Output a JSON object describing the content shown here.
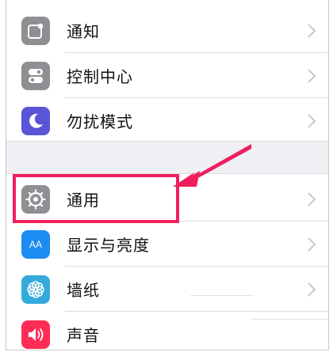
{
  "settings": {
    "items": [
      {
        "label": "通知",
        "icon": "notifications-icon"
      },
      {
        "label": "控制中心",
        "icon": "control-center-icon"
      },
      {
        "label": "勿扰模式",
        "icon": "do-not-disturb-icon"
      },
      {
        "label": "通用",
        "icon": "gear-icon"
      },
      {
        "label": "显示与亮度",
        "icon": "display-brightness-icon",
        "glyph": "AA"
      },
      {
        "label": "墙纸",
        "icon": "wallpaper-icon"
      },
      {
        "label": "声音",
        "icon": "sound-icon"
      }
    ]
  },
  "colors": {
    "highlight": "#ef1f5c",
    "gray_icon": "#8e8e93",
    "purple_icon": "#5856d6",
    "blue_icon": "#1b8cf2",
    "teal_icon": "#34aadc",
    "red_icon": "#ff2d55"
  }
}
